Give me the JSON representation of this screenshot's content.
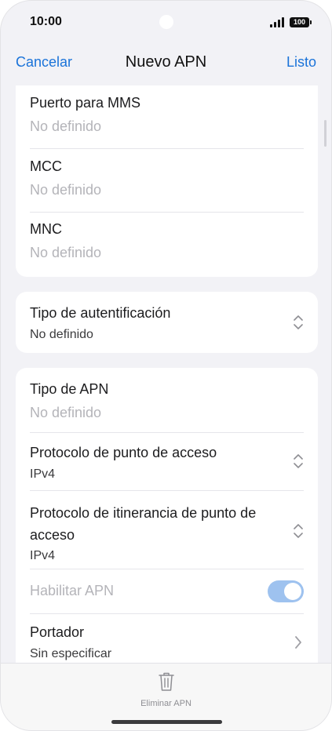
{
  "status_bar": {
    "time": "10:00",
    "battery": "100"
  },
  "nav": {
    "cancel_label": "Cancelar",
    "title": "Nuevo APN",
    "done_label": "Listo"
  },
  "card1": {
    "mms_port": {
      "label": "Puerto para MMS",
      "value": "No definido"
    },
    "mcc": {
      "label": "MCC",
      "value": "No definido"
    },
    "mnc": {
      "label": "MNC",
      "value": "No definido"
    }
  },
  "card2": {
    "auth_type": {
      "label": "Tipo de autentificación",
      "value": "No definido"
    }
  },
  "card3": {
    "apn_type": {
      "label": "Tipo de APN",
      "value": "No definido"
    },
    "apn_protocol": {
      "label": "Protocolo de punto de acceso",
      "value": "IPv4"
    },
    "roaming_protocol": {
      "label_line1": "Protocolo de itinerancia de punto de",
      "label_line2": "acceso",
      "value": "IPv4"
    },
    "enable_apn": {
      "label": "Habilitar APN",
      "enabled": true
    },
    "bearer": {
      "label": "Portador",
      "value": "Sin especificar"
    }
  },
  "bottom": {
    "delete_label": "Eliminar APN"
  },
  "colors": {
    "accent": "#1a73d9",
    "toggle_on_disabled": "#9ec2ef",
    "placeholder": "#b4b4b9"
  },
  "icons": [
    "signal-icon",
    "battery-icon",
    "updown-icon",
    "chevron-right-icon",
    "trash-icon"
  ]
}
